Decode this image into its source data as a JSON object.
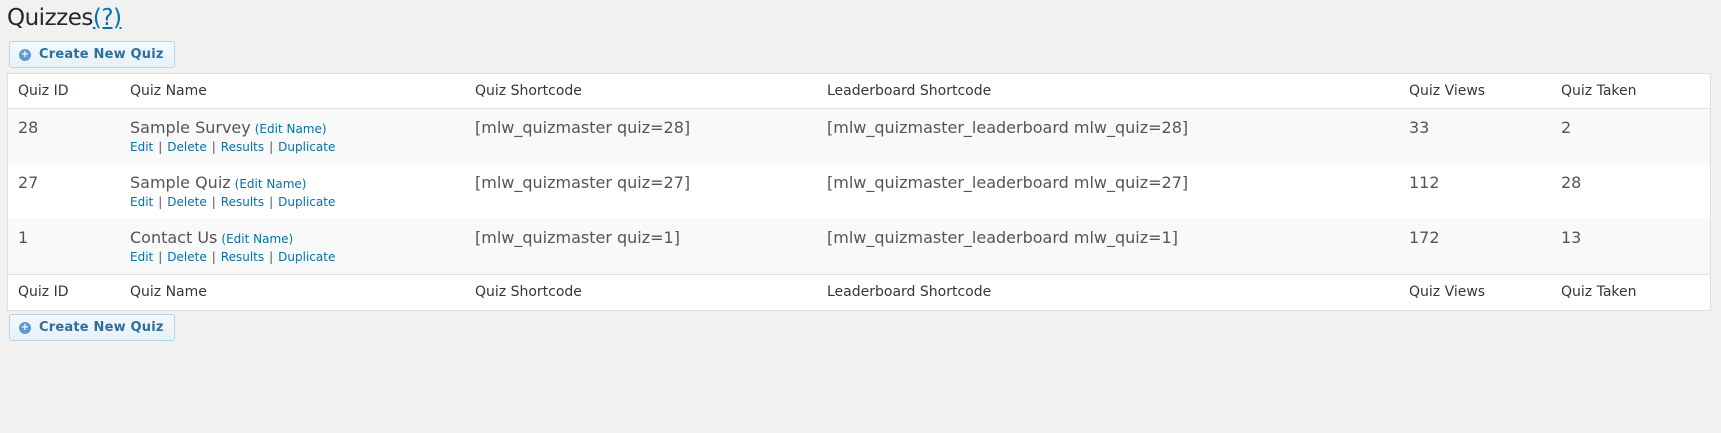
{
  "page": {
    "title": "Quizzes",
    "help_link": "(?)"
  },
  "buttons": {
    "create_new_quiz": "Create New Quiz"
  },
  "table": {
    "columns": [
      "Quiz ID",
      "Quiz Name",
      "Quiz Shortcode",
      "Leaderboard Shortcode",
      "Quiz Views",
      "Quiz Taken"
    ],
    "edit_name_label": "(Edit Name)",
    "action_labels": [
      "Edit",
      "Delete",
      "Results",
      "Duplicate"
    ],
    "action_separator": "|",
    "rows": [
      {
        "id": "28",
        "name": "Sample Survey",
        "shortcode": "[mlw_quizmaster quiz=28]",
        "leaderboard": "[mlw_quizmaster_leaderboard mlw_quiz=28]",
        "views": "33",
        "taken": "2"
      },
      {
        "id": "27",
        "name": "Sample Quiz",
        "shortcode": "[mlw_quizmaster quiz=27]",
        "leaderboard": "[mlw_quizmaster_leaderboard mlw_quiz=27]",
        "views": "112",
        "taken": "28"
      },
      {
        "id": "1",
        "name": "Contact Us",
        "shortcode": "[mlw_quizmaster quiz=1]",
        "leaderboard": "[mlw_quizmaster_leaderboard mlw_quiz=1]",
        "views": "172",
        "taken": "13"
      }
    ]
  },
  "colors": {
    "background": "#f1f1f1",
    "link": "#0073aa",
    "button_border": "#b7d5ea",
    "button_text": "#2c6f9c",
    "plus_icon": "#5b9bd1"
  },
  "icons": {
    "create_button": "plus-circle-icon"
  }
}
